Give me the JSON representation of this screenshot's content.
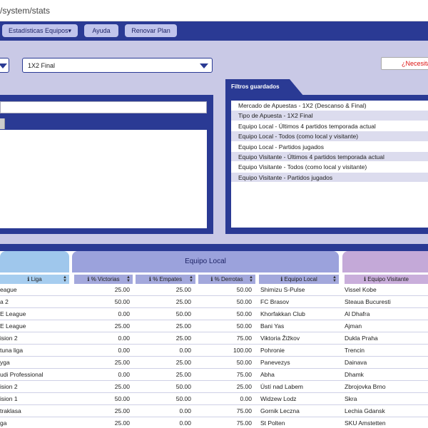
{
  "browser": {
    "url": "/system/stats"
  },
  "nav": {
    "stats_label": "Estadísticas Equipos▾",
    "help_label": "Ayuda",
    "renew_label": "Renovar Plan"
  },
  "market_select": {
    "value": "1X2 Final"
  },
  "help_button": {
    "label": "¿Necesitas"
  },
  "saved_filters": {
    "title": "Filtros guardados",
    "items": [
      "Mercado de Apuestas - 1X2 (Descanso & Final)",
      "Tipo de Apuesta - 1X2 Final",
      "Equipo Local - Últimos 4 partidos temporada actual",
      "Equipo Local - Todos (como local y visitante)",
      "Equipo Local - Partidos jugados",
      "Equipo Visitante - Últimos 4 partidos temporada actual",
      "Equipo Visitante - Todos (como local y visitante)",
      "Equipo Visitante - Partidos jugados"
    ]
  },
  "results": {
    "group_local": "Equipo Local",
    "columns": {
      "liga": "Liga",
      "victorias": "% Victorias",
      "empates": "% Empates",
      "derrotas": "% Derrotas",
      "local": "Equipo Local",
      "visitante": "Equipo Visitante"
    },
    "rows": [
      {
        "liga": "eague",
        "vic": "25.00",
        "emp": "25.00",
        "der": "50.00",
        "local": "Shimizu S-Pulse",
        "visit": "Vissel Kobe"
      },
      {
        "liga": "a 2",
        "vic": "50.00",
        "emp": "25.00",
        "der": "50.00",
        "local": "FC Brasov",
        "visit": "Steaua Bucuresti"
      },
      {
        "liga": "E League",
        "vic": "0.00",
        "emp": "50.00",
        "der": "50.00",
        "local": "Khorfakkan Club",
        "visit": "Al Dhafra"
      },
      {
        "liga": "E League",
        "vic": "25.00",
        "emp": "25.00",
        "der": "50.00",
        "local": "Bani Yas",
        "visit": "Ajman"
      },
      {
        "liga": "ision 2",
        "vic": "0.00",
        "emp": "25.00",
        "der": "75.00",
        "local": "Viktoria Žižkov",
        "visit": "Dukla Praha"
      },
      {
        "liga": "tuna liga",
        "vic": "0.00",
        "emp": "0.00",
        "der": "100.00",
        "local": "Pohronie",
        "visit": "Trencin"
      },
      {
        "liga": "yga",
        "vic": "25.00",
        "emp": "25.00",
        "der": "50.00",
        "local": "Panevezys",
        "visit": "Dainava"
      },
      {
        "liga": "udi Professional",
        "vic": "0.00",
        "emp": "25.00",
        "der": "75.00",
        "local": "Abha",
        "visit": "Dhamk"
      },
      {
        "liga": "ision 2",
        "vic": "25.00",
        "emp": "50.00",
        "der": "25.00",
        "local": "Ústí nad Labem",
        "visit": "Zbrojovka Brno"
      },
      {
        "liga": "ision 1",
        "vic": "50.00",
        "emp": "50.00",
        "der": "0.00",
        "local": "Widzew Lodz",
        "visit": "Skra"
      },
      {
        "liga": "traklasa",
        "vic": "25.00",
        "emp": "0.00",
        "der": "75.00",
        "local": "Gornik Leczna",
        "visit": "Lechia Gdansk"
      },
      {
        "liga": "ga",
        "vic": "25.00",
        "emp": "0.00",
        "der": "75.00",
        "local": "St Polten",
        "visit": "SKU Amstetten"
      }
    ]
  }
}
